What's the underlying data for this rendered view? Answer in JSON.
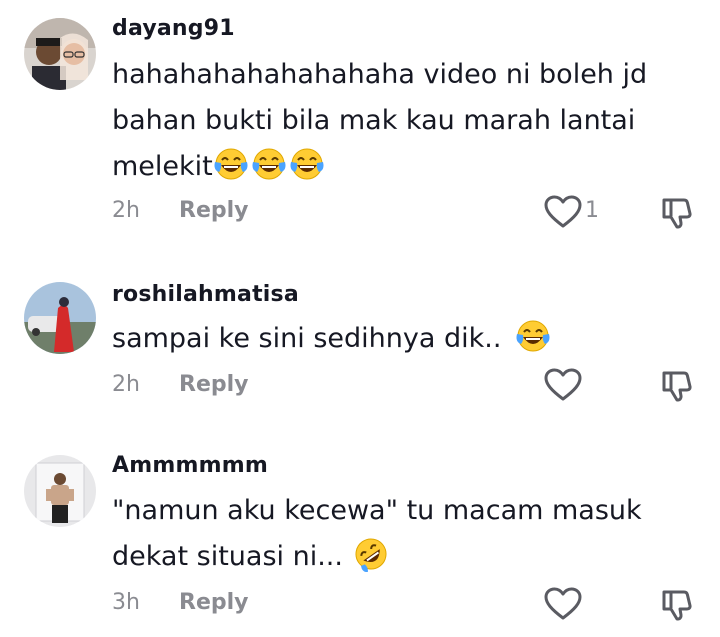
{
  "comments": [
    {
      "username": "dayang91",
      "text": "hahahahahahahahaha video ni boleh jd bahan bukti bila mak kau marah lantai melekit",
      "emoji": [
        "face-with-tears-of-joy",
        "face-with-tears-of-joy",
        "face-with-tears-of-joy"
      ],
      "time": "2h",
      "reply_label": "Reply",
      "like_count": "1"
    },
    {
      "username": "roshilahmatisa",
      "text": "sampai ke sini sedihnya dik..",
      "emoji": [
        "face-with-tears-of-joy"
      ],
      "time": "2h",
      "reply_label": "Reply",
      "like_count": ""
    },
    {
      "username": "Ammmmmm",
      "text": "\"namun aku kecewa\" tu macam masuk dekat situasi ni...",
      "emoji": [
        "rolling-on-the-floor-laughing"
      ],
      "time": "3h",
      "reply_label": "Reply",
      "like_count": ""
    }
  ],
  "icons": {
    "like": "heart-outline-icon",
    "dislike": "thumbs-down-icon"
  },
  "colors": {
    "text": "#161823",
    "muted": "#8a8b91",
    "emoji_face": "#ffcc33"
  }
}
